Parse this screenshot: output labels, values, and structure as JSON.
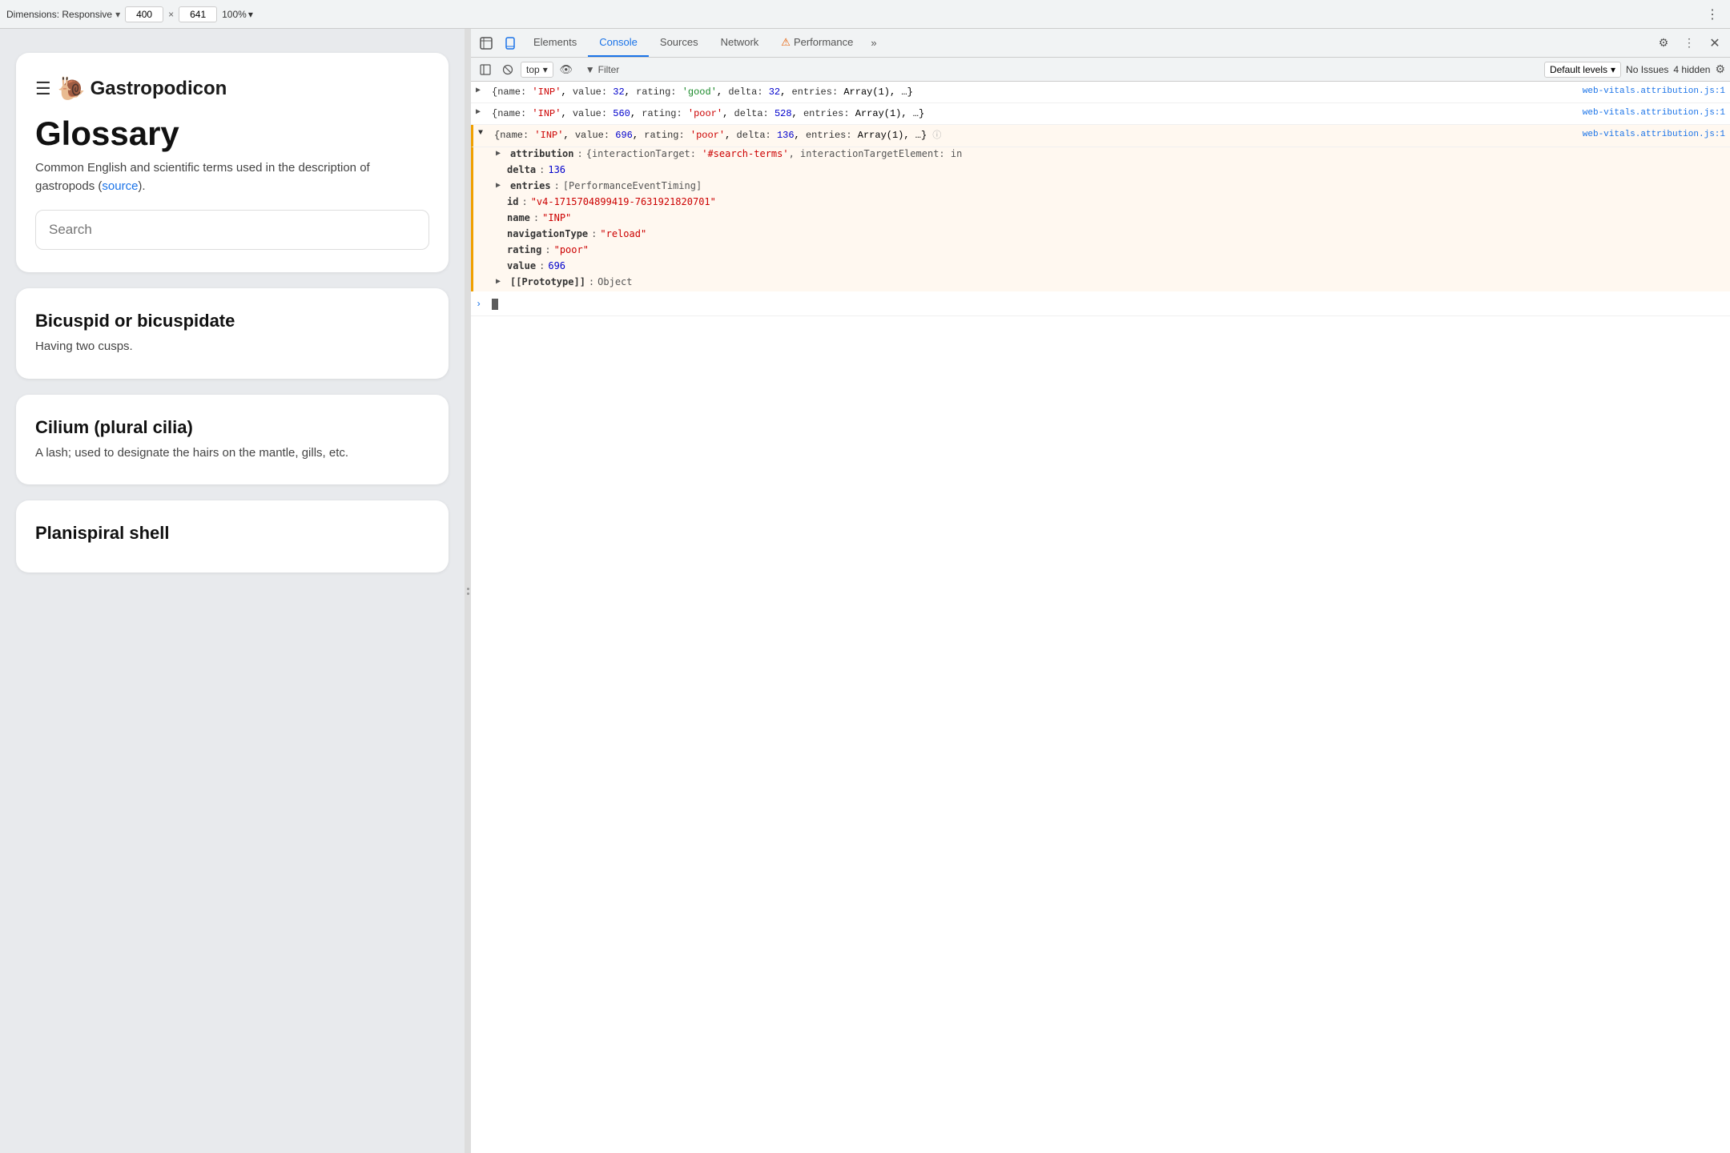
{
  "topbar": {
    "dimensions_label": "Dimensions: Responsive",
    "width": "400",
    "height": "641",
    "zoom": "100%",
    "chevron": "▾"
  },
  "site": {
    "hamburger": "☰",
    "snail": "🐌",
    "title": "Gastropodicon",
    "glossary_title": "Glossary",
    "glossary_desc": "Common English and scientific terms used in the description of gastropods (",
    "source_link": "source",
    "desc_end": ").",
    "search_placeholder": "Search"
  },
  "terms": [
    {
      "title": "Bicuspid or bicuspidate",
      "definition": "Having two cusps."
    },
    {
      "title": "Cilium (plural cilia)",
      "definition": "A lash; used to designate the hairs on the mantle, gills, etc."
    },
    {
      "title": "Planispiral shell",
      "definition": ""
    }
  ],
  "devtools": {
    "tabs": [
      "Elements",
      "Console",
      "Sources",
      "Network",
      "Performance"
    ],
    "active_tab": "Console",
    "more_tabs": "»",
    "context": "top",
    "filter_label": "Filter",
    "levels_label": "Default levels",
    "no_issues": "No Issues",
    "hidden_count": "4 hidden"
  },
  "console": {
    "entries": [
      {
        "id": "entry1",
        "collapsed": true,
        "link": "web-vitals.attribution.js:1",
        "text": "{name: 'INP', value: 32, rating: 'good', delta: 32, entries: Array(1), …}"
      },
      {
        "id": "entry2",
        "collapsed": true,
        "link": "web-vitals.attribution.js:1",
        "text": "{name: 'INP', value: 560, rating: 'poor', delta: 528, entries: Array(1), …}"
      },
      {
        "id": "entry3",
        "collapsed": false,
        "link": "web-vitals.attribution.js:1",
        "text": "{name: 'INP', value: 696, rating: 'poor', delta: 136, entries: Array(1), …}",
        "expanded_props": [
          {
            "key": "attribution",
            "val": "{interactionTarget: '#search-terms', interactionTargetElement: in",
            "type": "obj"
          },
          {
            "key": "delta",
            "val": "136",
            "type": "num"
          },
          {
            "key": "entries",
            "val": "[PerformanceEventTiming]",
            "type": "obj"
          },
          {
            "key": "id",
            "val": "\"v4-1715704899419-7631921820701\"",
            "type": "str"
          },
          {
            "key": "name",
            "val": "\"INP\"",
            "type": "str"
          },
          {
            "key": "navigationType",
            "val": "\"reload\"",
            "type": "str"
          },
          {
            "key": "rating",
            "val": "\"poor\"",
            "type": "str"
          },
          {
            "key": "value",
            "val": "696",
            "type": "num"
          },
          {
            "key": "[[Prototype]]",
            "val": "Object",
            "type": "obj"
          }
        ]
      }
    ],
    "input_prompt": ">"
  }
}
